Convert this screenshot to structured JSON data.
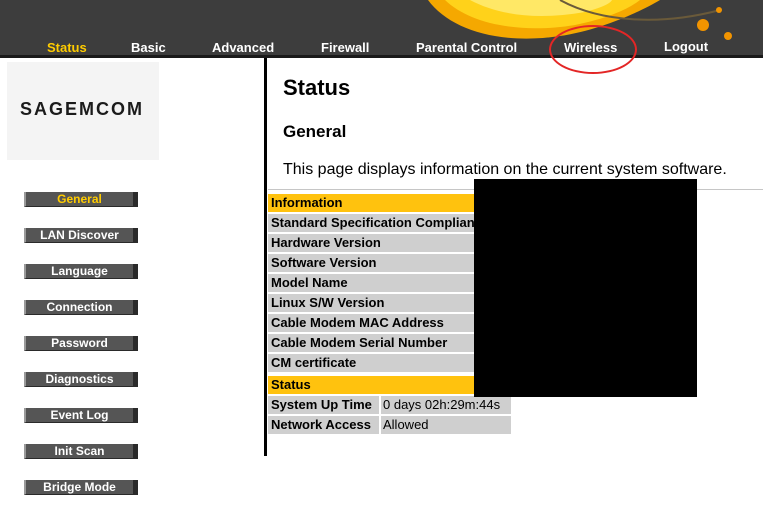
{
  "nav": {
    "items": [
      {
        "label": "Status",
        "active": true
      },
      {
        "label": "Basic",
        "active": false
      },
      {
        "label": "Advanced",
        "active": false
      },
      {
        "label": "Firewall",
        "active": false
      },
      {
        "label": "Parental Control",
        "active": false
      },
      {
        "label": "Wireless",
        "active": false
      },
      {
        "label": "Logout",
        "active": false
      }
    ]
  },
  "brand": {
    "logo_text": "SAGEMCOM"
  },
  "sidebar": {
    "items": [
      {
        "label": "General",
        "active": true
      },
      {
        "label": "LAN Discover",
        "active": false
      },
      {
        "label": "Language",
        "active": false
      },
      {
        "label": "Connection",
        "active": false
      },
      {
        "label": "Password",
        "active": false
      },
      {
        "label": "Diagnostics",
        "active": false
      },
      {
        "label": "Event Log",
        "active": false
      },
      {
        "label": "Init Scan",
        "active": false
      },
      {
        "label": "Bridge Mode",
        "active": false
      }
    ]
  },
  "main": {
    "title": "Status",
    "section": "General",
    "description": "This page displays information on the current system software."
  },
  "info_table": {
    "header": "Information",
    "rows": [
      {
        "label": "Standard Specification Compliant"
      },
      {
        "label": "Hardware Version"
      },
      {
        "label": "Software Version"
      },
      {
        "label": "Model Name"
      },
      {
        "label": "Linux S/W Version"
      },
      {
        "label": "Cable Modem MAC Address"
      },
      {
        "label": "Cable Modem Serial Number"
      },
      {
        "label": "CM certificate"
      }
    ]
  },
  "status_table": {
    "header": "Status",
    "rows": [
      {
        "label": "System Up Time",
        "value": "0 days 02h:29m:44s"
      },
      {
        "label": "Network Access",
        "value": "Allowed"
      }
    ]
  },
  "colors": {
    "nav_bg": "#3d3d3d",
    "accent_yellow": "#ffc20e",
    "nav_active": "#ffcc00",
    "row_bg": "#cfcfcf",
    "highlight_ring": "#e32626"
  }
}
